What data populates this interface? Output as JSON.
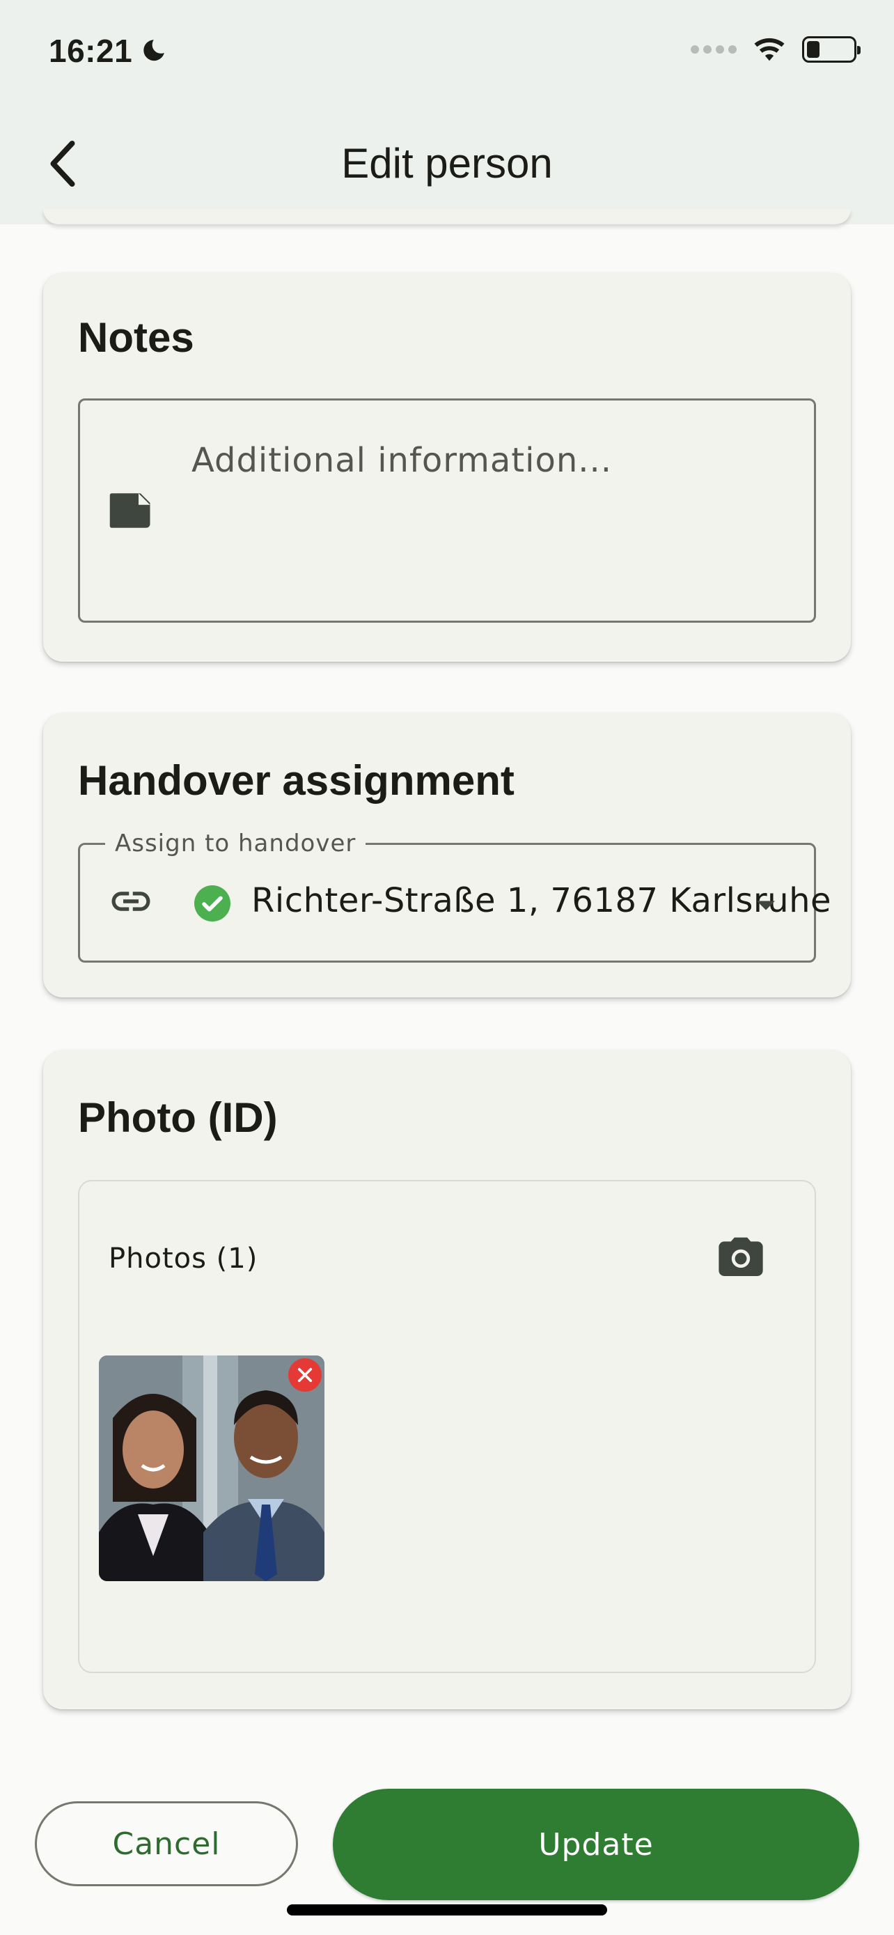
{
  "status_bar": {
    "time": "16:21"
  },
  "app_bar": {
    "title": "Edit person"
  },
  "notes": {
    "title": "Notes",
    "placeholder": "Additional information..."
  },
  "handover": {
    "title": "Handover assignment",
    "field_label": "Assign to handover",
    "selected_value": "Richter-Straße 1, 76187 Karlsruhe"
  },
  "photo": {
    "title": "Photo (ID)",
    "count_label": "Photos (1)"
  },
  "actions": {
    "cancel_label": "Cancel",
    "update_label": "Update"
  },
  "colors": {
    "primary": "#2e7d32",
    "card_bg": "#f1f3ec",
    "appbar_bg": "#edf1ed",
    "success": "#4caf50",
    "danger": "#e53935"
  },
  "icons": [
    "moon-icon",
    "wifi-icon",
    "battery-icon",
    "back-arrow-icon",
    "note-icon",
    "link-icon",
    "check-circle-icon",
    "dropdown-arrow-icon",
    "camera-icon",
    "close-icon"
  ]
}
